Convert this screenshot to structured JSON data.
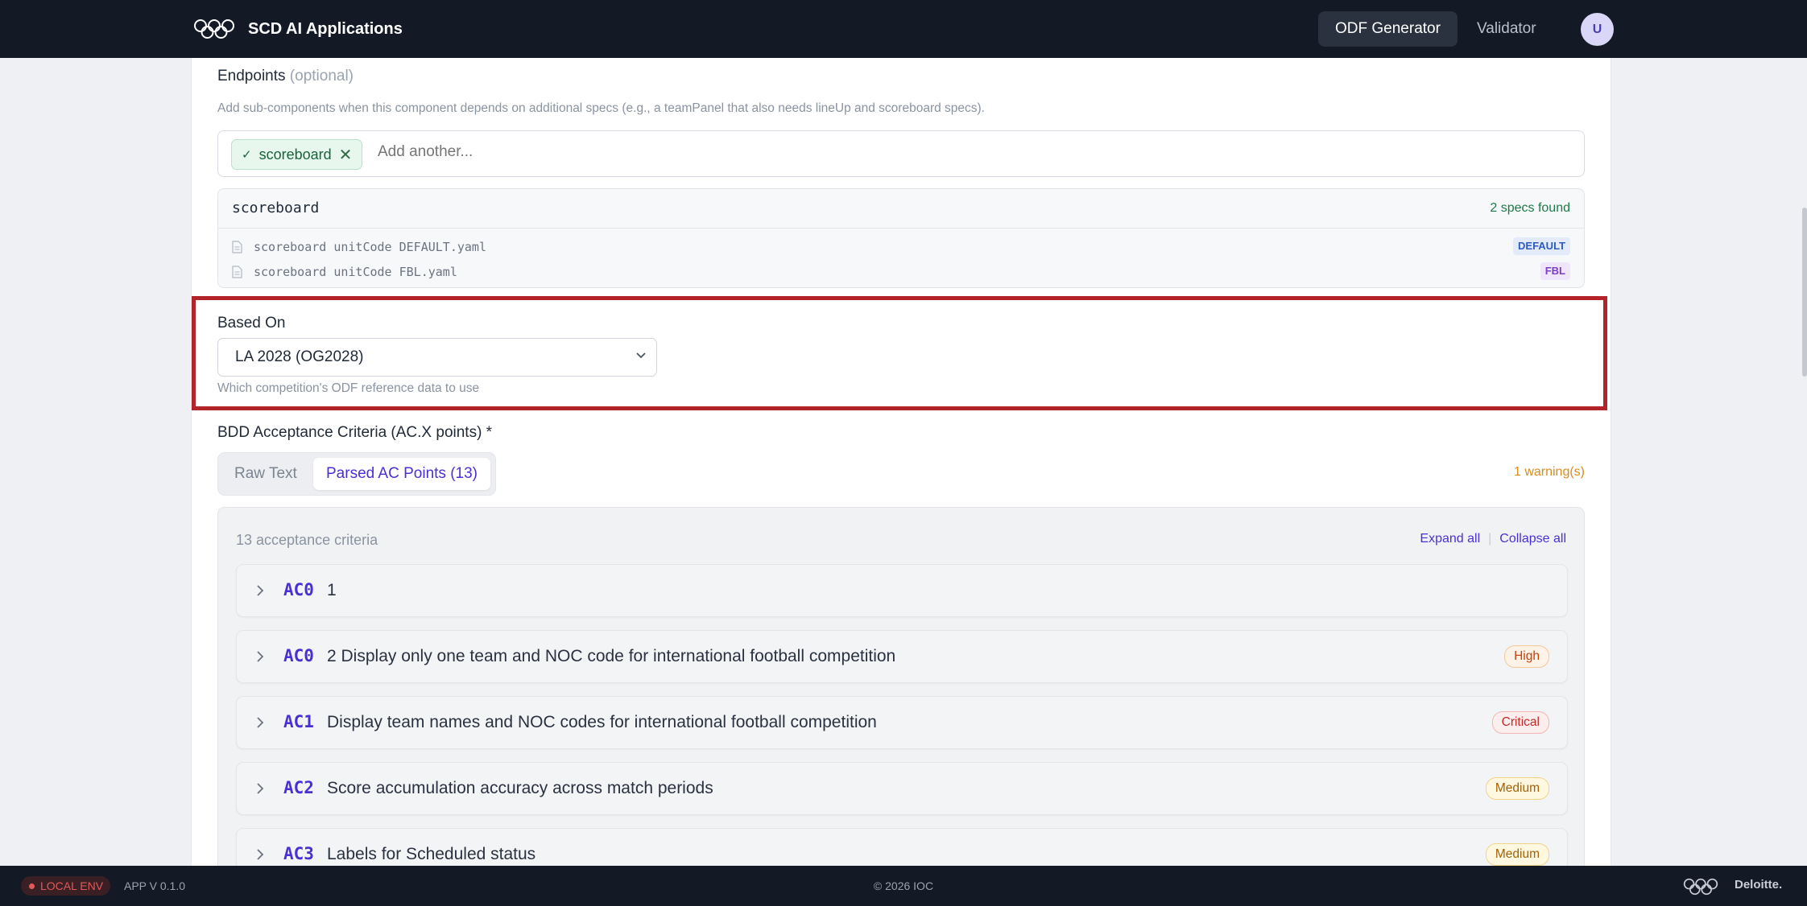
{
  "app": {
    "title": "SCD AI Applications",
    "user_initial": "U"
  },
  "nav": {
    "items": [
      {
        "label": "ODF Generator",
        "active": true
      },
      {
        "label": "Validator",
        "active": false
      }
    ]
  },
  "endpoints": {
    "label": "Endpoints",
    "optional": "(optional)",
    "hint": "Add sub-components when this component depends on additional specs (e.g., a teamPanel that also needs lineUp and scoreboard specs).",
    "chips": [
      {
        "check": "✓",
        "label": "scoreboard",
        "remove": "✕"
      }
    ],
    "placeholder": "Add another...",
    "spec": {
      "name": "scoreboard",
      "count": "2 specs found",
      "files": [
        {
          "name": "scoreboard unitCode DEFAULT.yaml",
          "tag": "DEFAULT"
        },
        {
          "name": "scoreboard unitCode FBL.yaml",
          "tag": "FBL"
        }
      ]
    }
  },
  "based_on": {
    "label": "Based On",
    "selected": "LA 2028 (OG2028)",
    "hint": "Which competition's ODF reference data to use"
  },
  "bdd": {
    "label": "BDD Acceptance Criteria (AC.X points) *",
    "tabs": [
      {
        "label": "Raw Text",
        "active": false
      },
      {
        "label": "Parsed AC Points (13)",
        "active": true
      }
    ],
    "warning": "1 warning(s)",
    "count": "13 acceptance criteria",
    "expand_all": "Expand all",
    "separator": "|",
    "collapse_all": "Collapse all",
    "items": [
      {
        "code": "AC0",
        "title": "1",
        "priority": ""
      },
      {
        "code": "AC0",
        "title": "2 Display only one team and NOC code for international football competition",
        "priority": "High"
      },
      {
        "code": "AC1",
        "title": "Display team names and NOC codes for international football competition",
        "priority": "Critical"
      },
      {
        "code": "AC2",
        "title": "Score accumulation accuracy across match periods",
        "priority": "Medium"
      },
      {
        "code": "AC3",
        "title": "Labels for Scheduled status",
        "priority": "Medium"
      }
    ]
  },
  "footer": {
    "env": "LOCAL ENV",
    "version": "APP V 0.1.0",
    "copyright": "© 2026 IOC",
    "brand": "Deloitte."
  },
  "colors": {
    "accent": "#4b2fd6",
    "topbar": "#131a26",
    "highlight_border": "#b3242a"
  }
}
